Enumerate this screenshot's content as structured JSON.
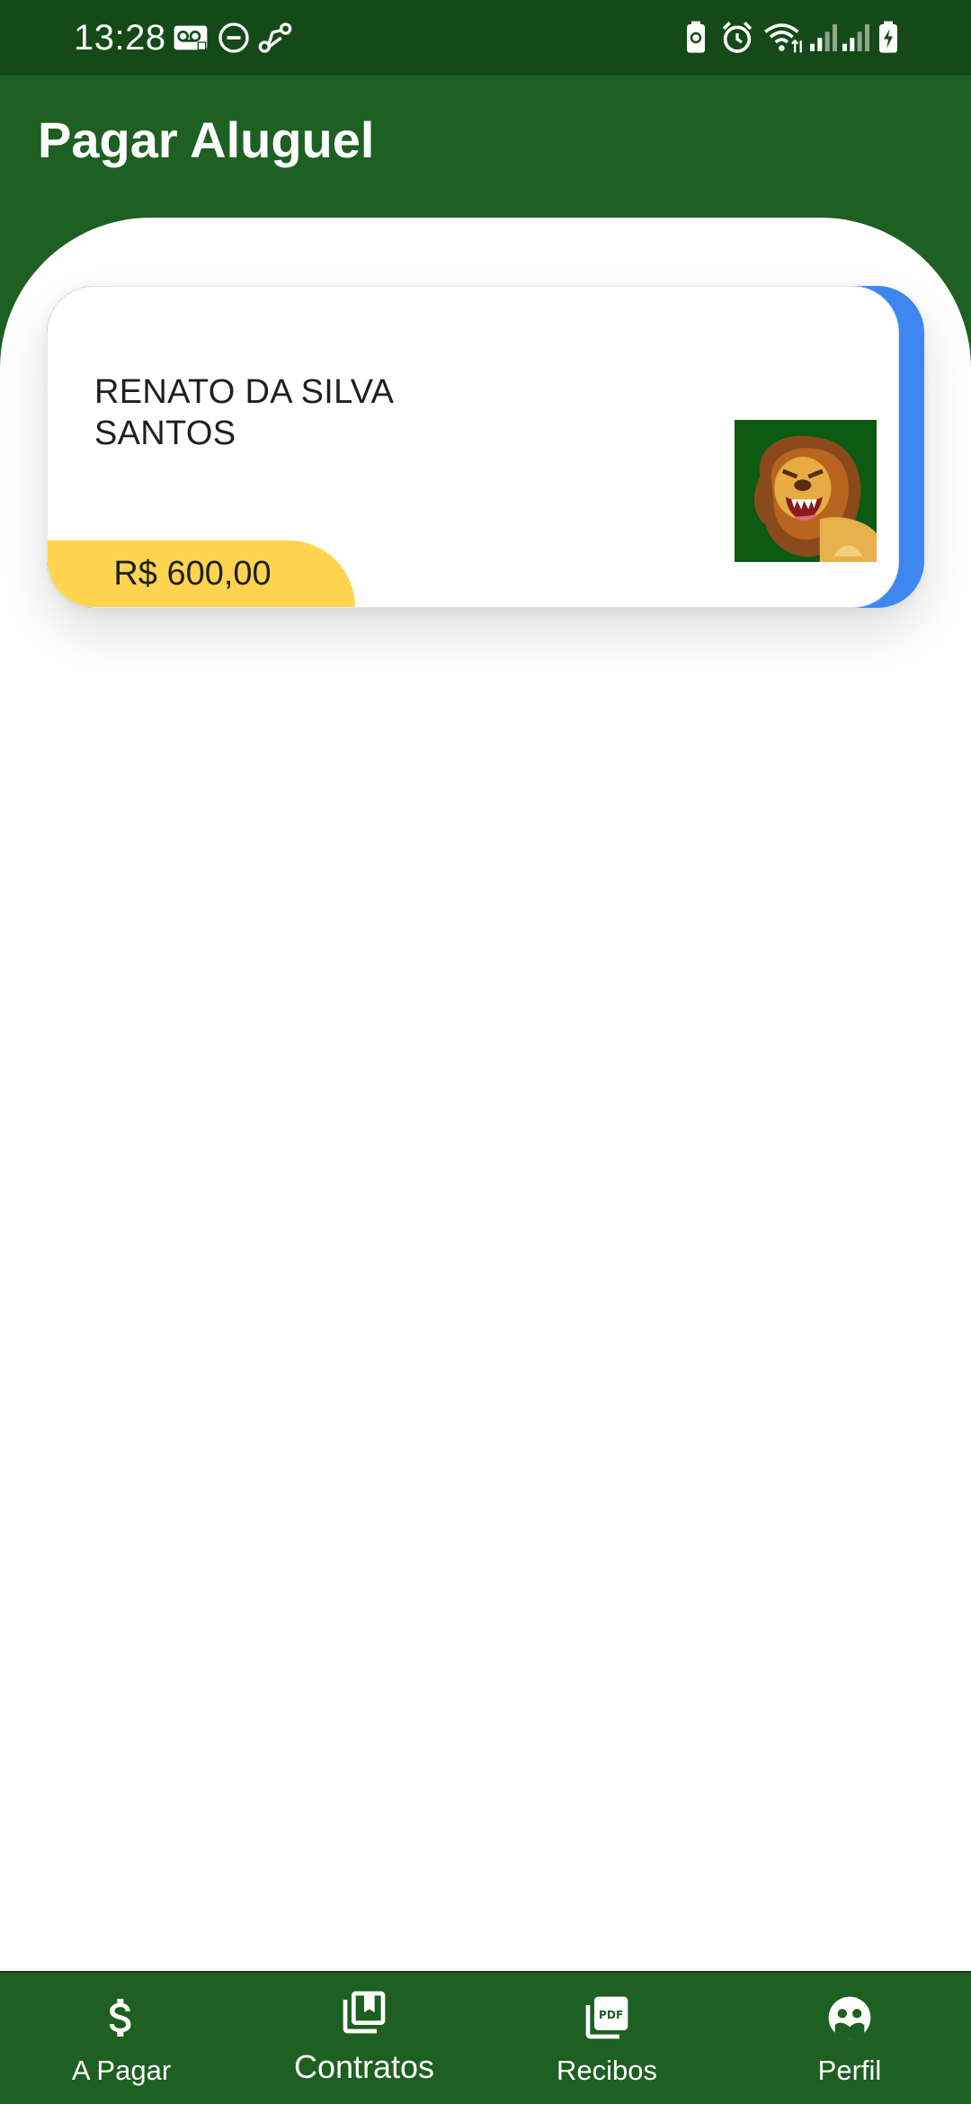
{
  "status_bar": {
    "time": "13:28",
    "left_icons": [
      "voicemail-icon",
      "do-not-disturb-icon",
      "link-icon"
    ],
    "right_icons": [
      "battery-saver-icon",
      "alarm-icon",
      "wifi-icon",
      "signal-1-icon",
      "signal-2-icon",
      "battery-charging-icon"
    ]
  },
  "header": {
    "title": "Pagar Aluguel"
  },
  "contracts": [
    {
      "tenant_name": "RENATO DA SILVA SANTOS",
      "amount": "R$ 600,00",
      "avatar_icon": "lion-avatar-icon"
    }
  ],
  "bottom_nav": {
    "items": [
      {
        "label": "A Pagar",
        "icon": "dollar-icon"
      },
      {
        "label": "Contratos",
        "icon": "library-books-icon"
      },
      {
        "label": "Recibos",
        "icon": "pdf-icon"
      },
      {
        "label": "Perfil",
        "icon": "face-icon"
      }
    ]
  },
  "colors": {
    "status_bar": "#154a18",
    "primary": "#1e5f22",
    "card_accent": "#3f87f0",
    "price_badge": "#ffd54f",
    "avatar_bg": "#0d5a12"
  }
}
